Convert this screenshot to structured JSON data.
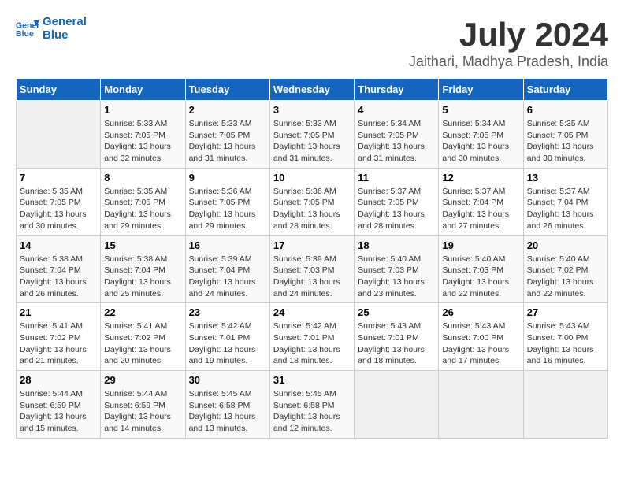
{
  "header": {
    "logo_line1": "General",
    "logo_line2": "Blue",
    "month_year": "July 2024",
    "location": "Jaithari, Madhya Pradesh, India"
  },
  "days_of_week": [
    "Sunday",
    "Monday",
    "Tuesday",
    "Wednesday",
    "Thursday",
    "Friday",
    "Saturday"
  ],
  "weeks": [
    [
      {
        "day": "",
        "sunrise": "",
        "sunset": "",
        "daylight": ""
      },
      {
        "day": "1",
        "sunrise": "Sunrise: 5:33 AM",
        "sunset": "Sunset: 7:05 PM",
        "daylight": "Daylight: 13 hours and 32 minutes."
      },
      {
        "day": "2",
        "sunrise": "Sunrise: 5:33 AM",
        "sunset": "Sunset: 7:05 PM",
        "daylight": "Daylight: 13 hours and 31 minutes."
      },
      {
        "day": "3",
        "sunrise": "Sunrise: 5:33 AM",
        "sunset": "Sunset: 7:05 PM",
        "daylight": "Daylight: 13 hours and 31 minutes."
      },
      {
        "day": "4",
        "sunrise": "Sunrise: 5:34 AM",
        "sunset": "Sunset: 7:05 PM",
        "daylight": "Daylight: 13 hours and 31 minutes."
      },
      {
        "day": "5",
        "sunrise": "Sunrise: 5:34 AM",
        "sunset": "Sunset: 7:05 PM",
        "daylight": "Daylight: 13 hours and 30 minutes."
      },
      {
        "day": "6",
        "sunrise": "Sunrise: 5:35 AM",
        "sunset": "Sunset: 7:05 PM",
        "daylight": "Daylight: 13 hours and 30 minutes."
      }
    ],
    [
      {
        "day": "7",
        "sunrise": "Sunrise: 5:35 AM",
        "sunset": "Sunset: 7:05 PM",
        "daylight": "Daylight: 13 hours and 30 minutes."
      },
      {
        "day": "8",
        "sunrise": "Sunrise: 5:35 AM",
        "sunset": "Sunset: 7:05 PM",
        "daylight": "Daylight: 13 hours and 29 minutes."
      },
      {
        "day": "9",
        "sunrise": "Sunrise: 5:36 AM",
        "sunset": "Sunset: 7:05 PM",
        "daylight": "Daylight: 13 hours and 29 minutes."
      },
      {
        "day": "10",
        "sunrise": "Sunrise: 5:36 AM",
        "sunset": "Sunset: 7:05 PM",
        "daylight": "Daylight: 13 hours and 28 minutes."
      },
      {
        "day": "11",
        "sunrise": "Sunrise: 5:37 AM",
        "sunset": "Sunset: 7:05 PM",
        "daylight": "Daylight: 13 hours and 28 minutes."
      },
      {
        "day": "12",
        "sunrise": "Sunrise: 5:37 AM",
        "sunset": "Sunset: 7:04 PM",
        "daylight": "Daylight: 13 hours and 27 minutes."
      },
      {
        "day": "13",
        "sunrise": "Sunrise: 5:37 AM",
        "sunset": "Sunset: 7:04 PM",
        "daylight": "Daylight: 13 hours and 26 minutes."
      }
    ],
    [
      {
        "day": "14",
        "sunrise": "Sunrise: 5:38 AM",
        "sunset": "Sunset: 7:04 PM",
        "daylight": "Daylight: 13 hours and 26 minutes."
      },
      {
        "day": "15",
        "sunrise": "Sunrise: 5:38 AM",
        "sunset": "Sunset: 7:04 PM",
        "daylight": "Daylight: 13 hours and 25 minutes."
      },
      {
        "day": "16",
        "sunrise": "Sunrise: 5:39 AM",
        "sunset": "Sunset: 7:04 PM",
        "daylight": "Daylight: 13 hours and 24 minutes."
      },
      {
        "day": "17",
        "sunrise": "Sunrise: 5:39 AM",
        "sunset": "Sunset: 7:03 PM",
        "daylight": "Daylight: 13 hours and 24 minutes."
      },
      {
        "day": "18",
        "sunrise": "Sunrise: 5:40 AM",
        "sunset": "Sunset: 7:03 PM",
        "daylight": "Daylight: 13 hours and 23 minutes."
      },
      {
        "day": "19",
        "sunrise": "Sunrise: 5:40 AM",
        "sunset": "Sunset: 7:03 PM",
        "daylight": "Daylight: 13 hours and 22 minutes."
      },
      {
        "day": "20",
        "sunrise": "Sunrise: 5:40 AM",
        "sunset": "Sunset: 7:02 PM",
        "daylight": "Daylight: 13 hours and 22 minutes."
      }
    ],
    [
      {
        "day": "21",
        "sunrise": "Sunrise: 5:41 AM",
        "sunset": "Sunset: 7:02 PM",
        "daylight": "Daylight: 13 hours and 21 minutes."
      },
      {
        "day": "22",
        "sunrise": "Sunrise: 5:41 AM",
        "sunset": "Sunset: 7:02 PM",
        "daylight": "Daylight: 13 hours and 20 minutes."
      },
      {
        "day": "23",
        "sunrise": "Sunrise: 5:42 AM",
        "sunset": "Sunset: 7:01 PM",
        "daylight": "Daylight: 13 hours and 19 minutes."
      },
      {
        "day": "24",
        "sunrise": "Sunrise: 5:42 AM",
        "sunset": "Sunset: 7:01 PM",
        "daylight": "Daylight: 13 hours and 18 minutes."
      },
      {
        "day": "25",
        "sunrise": "Sunrise: 5:43 AM",
        "sunset": "Sunset: 7:01 PM",
        "daylight": "Daylight: 13 hours and 18 minutes."
      },
      {
        "day": "26",
        "sunrise": "Sunrise: 5:43 AM",
        "sunset": "Sunset: 7:00 PM",
        "daylight": "Daylight: 13 hours and 17 minutes."
      },
      {
        "day": "27",
        "sunrise": "Sunrise: 5:43 AM",
        "sunset": "Sunset: 7:00 PM",
        "daylight": "Daylight: 13 hours and 16 minutes."
      }
    ],
    [
      {
        "day": "28",
        "sunrise": "Sunrise: 5:44 AM",
        "sunset": "Sunset: 6:59 PM",
        "daylight": "Daylight: 13 hours and 15 minutes."
      },
      {
        "day": "29",
        "sunrise": "Sunrise: 5:44 AM",
        "sunset": "Sunset: 6:59 PM",
        "daylight": "Daylight: 13 hours and 14 minutes."
      },
      {
        "day": "30",
        "sunrise": "Sunrise: 5:45 AM",
        "sunset": "Sunset: 6:58 PM",
        "daylight": "Daylight: 13 hours and 13 minutes."
      },
      {
        "day": "31",
        "sunrise": "Sunrise: 5:45 AM",
        "sunset": "Sunset: 6:58 PM",
        "daylight": "Daylight: 13 hours and 12 minutes."
      },
      {
        "day": "",
        "sunrise": "",
        "sunset": "",
        "daylight": ""
      },
      {
        "day": "",
        "sunrise": "",
        "sunset": "",
        "daylight": ""
      },
      {
        "day": "",
        "sunrise": "",
        "sunset": "",
        "daylight": ""
      }
    ]
  ]
}
